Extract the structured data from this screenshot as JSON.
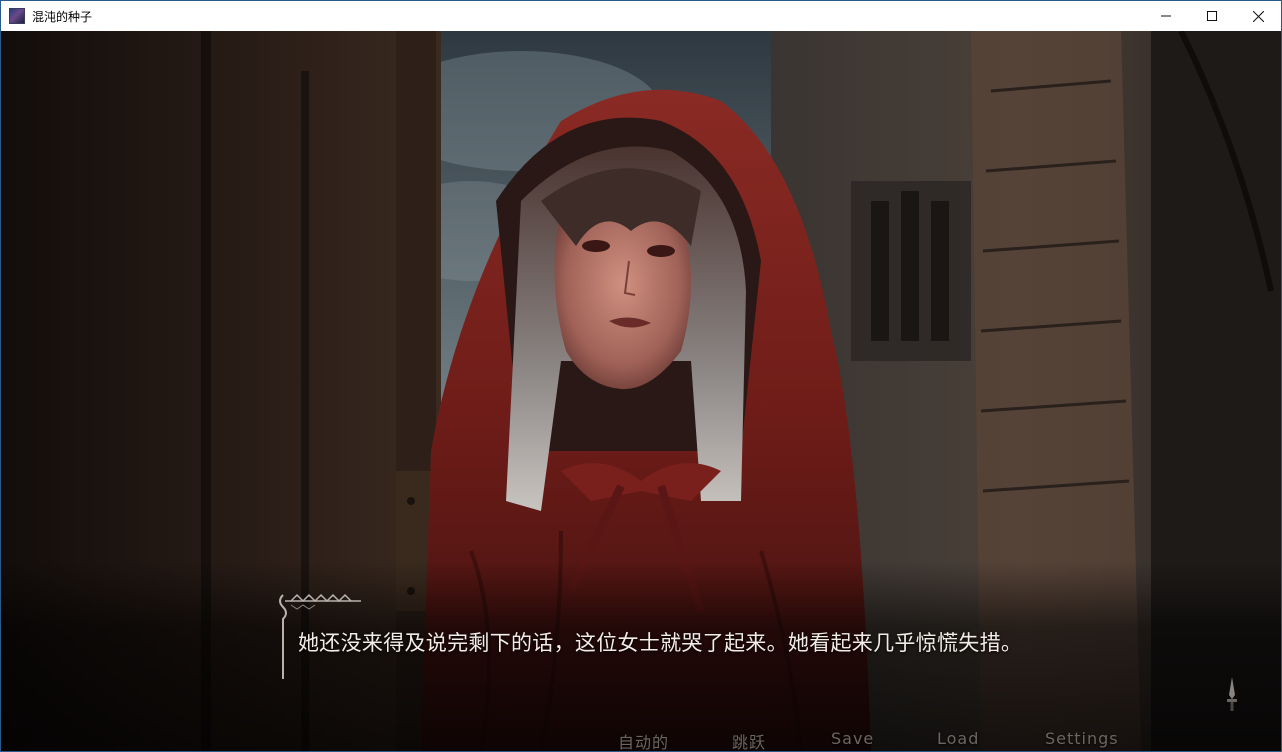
{
  "window": {
    "title": "混沌的种子",
    "controls": {
      "minimize_icon": "minimize-icon",
      "maximize_icon": "maximize-icon",
      "close_icon": "close-icon"
    }
  },
  "scene": {
    "description_icon": "hooded-girl-scene"
  },
  "dialogue": {
    "text": "她还没来得及说完剩下的话，这位女士就哭了起来。她看起来几乎惊慌失措。"
  },
  "quick_menu": {
    "auto": "自动的",
    "skip": "跳跃",
    "save": "Save",
    "load": "Load",
    "settings": "Settings"
  },
  "colors": {
    "titlebar_bg": "#ffffff",
    "window_border": "#2a5a8a",
    "dialogue_text": "#f2ece6",
    "quickmenu_text": "#6c6560",
    "cloak_red": "#8a2420"
  }
}
